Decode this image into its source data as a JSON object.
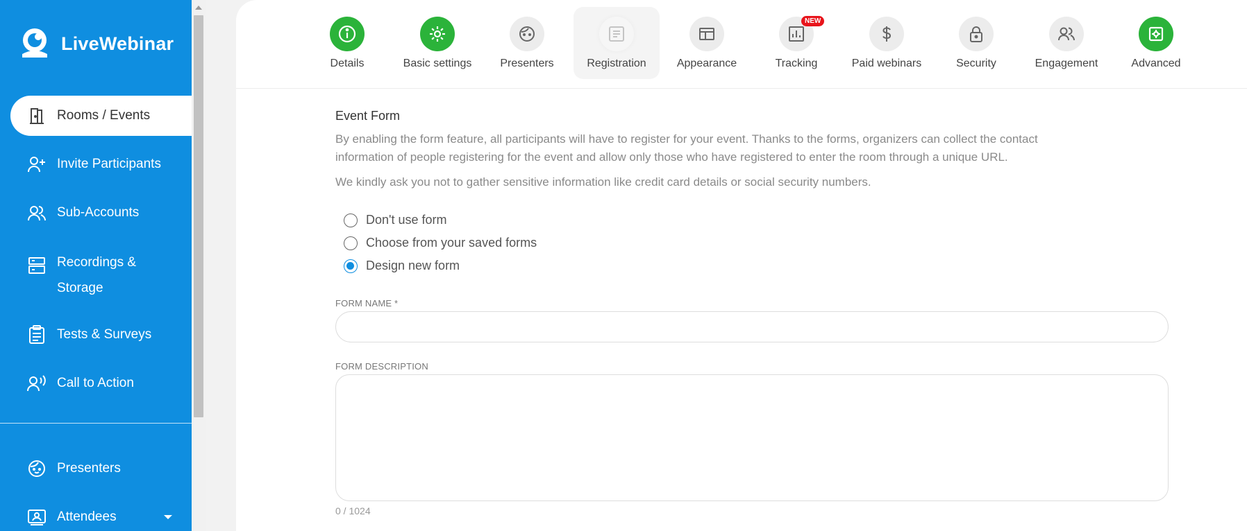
{
  "brand": {
    "name": "LiveWebinar"
  },
  "sidebar": {
    "items": [
      {
        "label": "Rooms / Events",
        "icon": "door-icon",
        "active": true
      },
      {
        "label": "Invite Participants",
        "icon": "user-plus-icon"
      },
      {
        "label": "Sub-Accounts",
        "icon": "users-icon"
      },
      {
        "label": "Recordings & Storage",
        "icon": "storage-icon"
      },
      {
        "label": "Tests & Surveys",
        "icon": "clipboard-icon"
      },
      {
        "label": "Call to Action",
        "icon": "user-voice-icon"
      }
    ],
    "bottom_items": [
      {
        "label": "Presenters",
        "icon": "face-icon"
      },
      {
        "label": "Attendees",
        "icon": "id-card-icon"
      }
    ]
  },
  "tabs": [
    {
      "label": "Details",
      "icon": "info-icon",
      "state": "complete"
    },
    {
      "label": "Basic settings",
      "icon": "gear-icon",
      "state": "complete"
    },
    {
      "label": "Presenters",
      "icon": "face-icon",
      "state": "default"
    },
    {
      "label": "Registration",
      "icon": "form-icon",
      "state": "active"
    },
    {
      "label": "Appearance",
      "icon": "layout-icon",
      "state": "default"
    },
    {
      "label": "Tracking",
      "icon": "chart-icon",
      "state": "default",
      "badge": "NEW"
    },
    {
      "label": "Paid webinars",
      "icon": "dollar-icon",
      "state": "default"
    },
    {
      "label": "Security",
      "icon": "lock-icon",
      "state": "default"
    },
    {
      "label": "Engagement",
      "icon": "users-icon",
      "state": "default"
    },
    {
      "label": "Advanced",
      "icon": "advanced-icon",
      "state": "complete"
    }
  ],
  "form": {
    "section_title": "Event Form",
    "description": "By enabling the form feature, all participants will have to register for your event. Thanks to the forms, organizers can collect the contact information of people registering for the event and allow only those who have registered to enter the room through a unique URL.",
    "notice": "We kindly ask you not to gather sensitive information like credit card details or social security numbers.",
    "options": [
      {
        "label": "Don't use form",
        "checked": false
      },
      {
        "label": "Choose from your saved forms",
        "checked": false
      },
      {
        "label": "Design new form",
        "checked": true
      }
    ],
    "name_label": "FORM NAME *",
    "name_value": "",
    "description_label": "FORM DESCRIPTION",
    "description_value": "",
    "counter": "0 / 1024"
  },
  "colors": {
    "brand": "#0f8ee0",
    "complete": "#2bb33a",
    "badge": "#e8141b"
  }
}
